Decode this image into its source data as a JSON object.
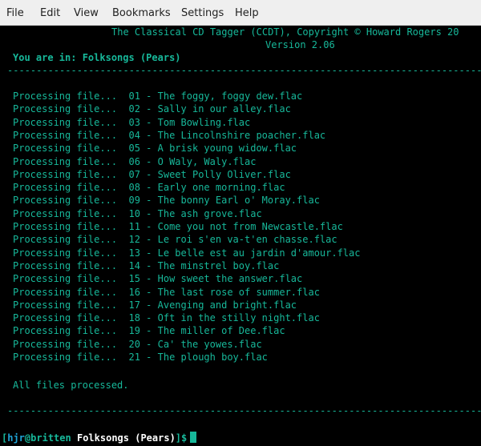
{
  "menu": {
    "items": [
      "File",
      "Edit",
      "View",
      "Bookmarks",
      "Settings",
      "Help"
    ]
  },
  "terminal": {
    "header_title": "The Classical CD Tagger (CCDT), Copyright © Howard Rogers 20",
    "header_version": "Version 2.06",
    "location_label": "You are in: Folksongs (Pears)",
    "processing_prefix": "Processing file...",
    "files": [
      "01 - The foggy, foggy dew.flac",
      "02 - Sally in our alley.flac",
      "03 - Tom Bowling.flac",
      "04 - The Lincolnshire poacher.flac",
      "05 - A brisk young widow.flac",
      "06 - O Waly, Waly.flac",
      "07 - Sweet Polly Oliver.flac",
      "08 - Early one morning.flac",
      "09 - The bonny Earl o' Moray.flac",
      "10 - The ash grove.flac",
      "11 - Come you not from Newcastle.flac",
      "12 - Le roi s'en va-t'en chasse.flac",
      "13 - Le belle est au jardin d'amour.flac",
      "14 - The minstrel boy.flac",
      "15 - How sweet the answer.flac",
      "16 - The last rose of summer.flac",
      "17 - Avenging and bright.flac",
      "18 - Oft in the stilly night.flac",
      "19 - The miller of Dee.flac",
      "20 - Ca' the yowes.flac",
      "21 - The plough boy.flac"
    ],
    "done_message": "All files processed.",
    "prompt": {
      "open_bracket": "[",
      "user": "hjr",
      "at": "@",
      "host": "britten",
      "cwd": "Folksongs (Pears)",
      "close": "]$"
    }
  },
  "colors": {
    "terminal_bg": "#000000",
    "terminal_fg": "#17b89a",
    "prompt_user": "#1fa4d6",
    "prompt_host": "#17b89a",
    "prompt_cwd": "#ffffff",
    "cursor": "#17b89a",
    "menubar_bg": "#efefef"
  }
}
